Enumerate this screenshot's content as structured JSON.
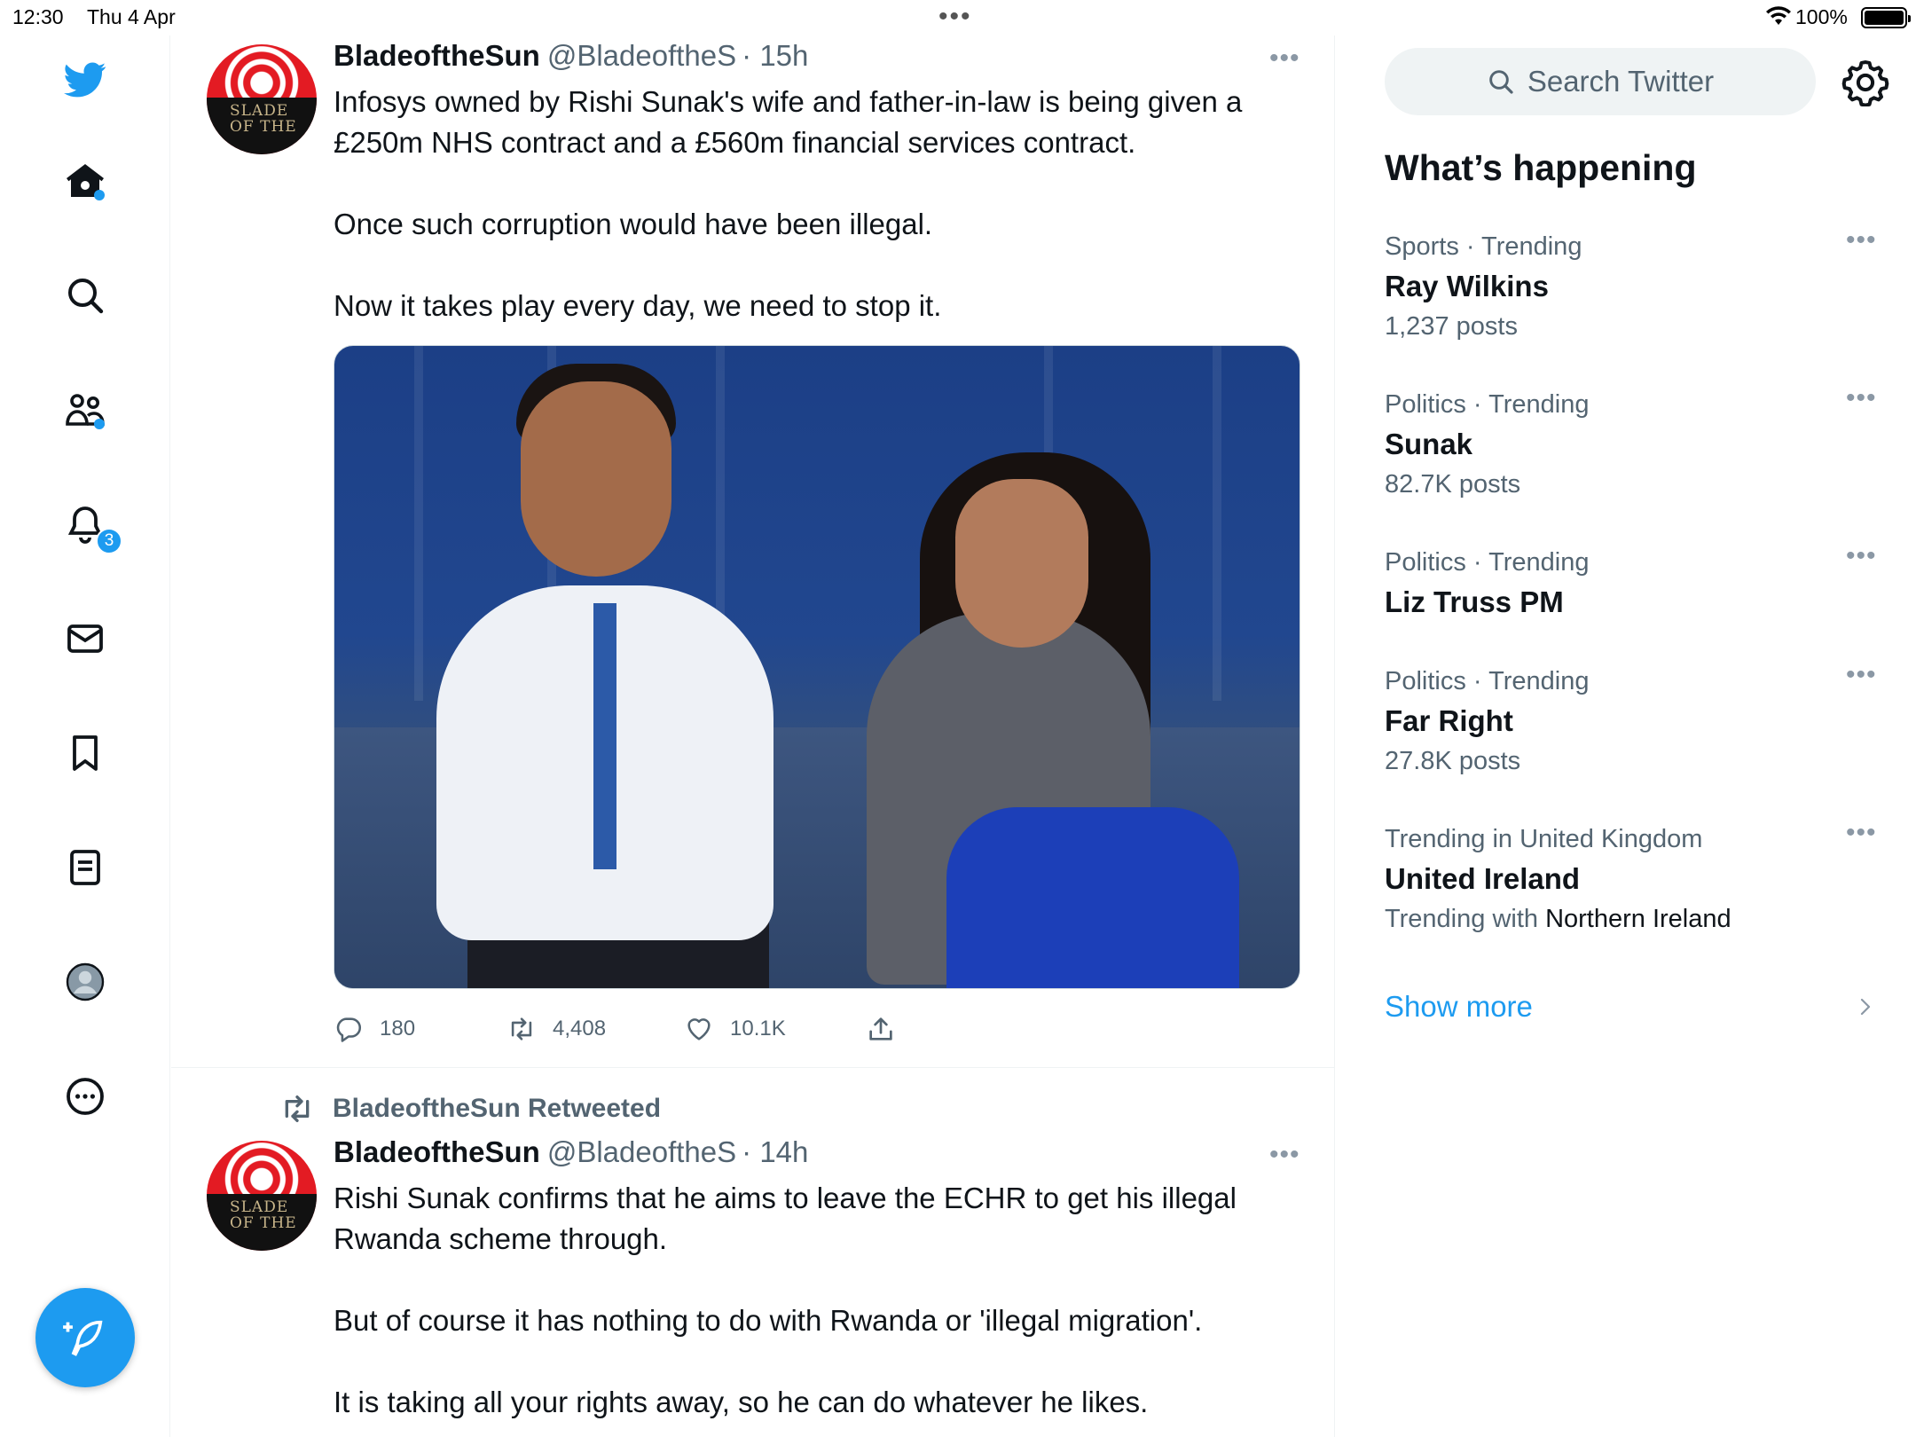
{
  "status_bar": {
    "time": "12:30",
    "date": "Thu 4 Apr",
    "battery": "100%"
  },
  "nav": {
    "items": [
      "twitter-logo",
      "home",
      "explore",
      "communities",
      "notifications",
      "messages",
      "bookmarks",
      "lists",
      "profile",
      "more"
    ],
    "notifications_count": "3"
  },
  "tweets": [
    {
      "name": "BladeoftheSun",
      "handle": "@BladeoftheS",
      "time": "· 15h",
      "paragraphs": [
        "Infosys owned by Rishi Sunak's wife and father-in-law is being given a £250m NHS contract and a £560m financial services contract.",
        "Once such corruption would have been illegal.",
        "Now it takes play every day, we need to stop it."
      ],
      "replies": "180",
      "retweets": "4,408",
      "likes": "10.1K"
    },
    {
      "retweeted_by": "BladeoftheSun Retweeted",
      "name": "BladeoftheSun",
      "handle": "@BladeoftheS",
      "time": "· 14h",
      "paragraphs": [
        "Rishi Sunak confirms that he aims to leave the ECHR to get his illegal Rwanda scheme through.",
        "But of course it has nothing to do with Rwanda or 'illegal migration'.",
        "It is taking all your rights away, so he can do whatever he likes."
      ]
    }
  ],
  "avatar_text": "BLADE OF THE SUN",
  "sidebar": {
    "search_placeholder": "Search Twitter",
    "heading": "What’s happening",
    "trends": [
      {
        "context": "Sports · Trending",
        "title": "Ray Wilkins",
        "meta": "1,237 posts"
      },
      {
        "context": "Politics · Trending",
        "title": "Sunak",
        "meta": "82.7K posts"
      },
      {
        "context": "Politics · Trending",
        "title": "Liz Truss PM",
        "meta": ""
      },
      {
        "context": "Politics · Trending",
        "title": "Far Right",
        "meta": "27.8K posts"
      },
      {
        "context": "Trending in United Kingdom",
        "title": "United Ireland",
        "meta_prefix": "Trending with ",
        "meta_link": "Northern Ireland"
      }
    ],
    "show_more": "Show more"
  },
  "colors": {
    "accent": "#1d9bf0",
    "text": "#0f1419",
    "secondary": "#536471"
  }
}
